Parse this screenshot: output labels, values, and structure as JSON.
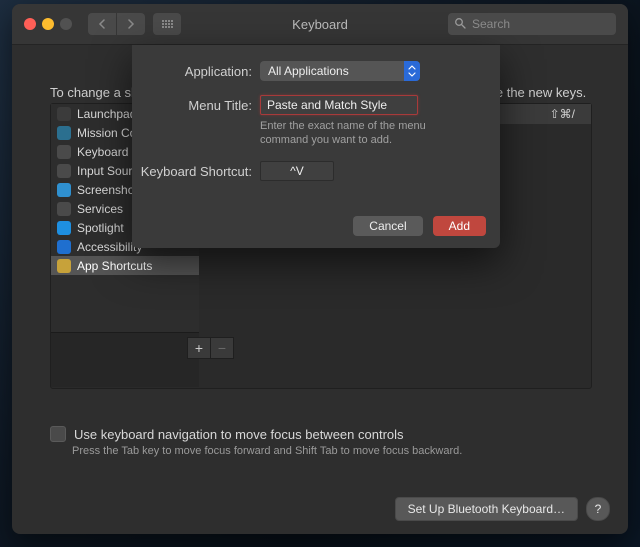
{
  "window": {
    "title": "Keyboard",
    "search_placeholder": "Search"
  },
  "main": {
    "intro_text": "To change a shortcut, select it, double-click the key combination, and then type the new keys.",
    "shortcut_display": "⇧⌘/"
  },
  "sidebar": {
    "items": [
      {
        "label": "Launchpad & Dock",
        "icon_bg": "#3b3b3b"
      },
      {
        "label": "Mission Control",
        "icon_bg": "#2b6f8f"
      },
      {
        "label": "Keyboard",
        "icon_bg": "#4a4a4a"
      },
      {
        "label": "Input Sources",
        "icon_bg": "#4a4a4a"
      },
      {
        "label": "Screenshots",
        "icon_bg": "#2f90d0"
      },
      {
        "label": "Services",
        "icon_bg": "#4a4a4a"
      },
      {
        "label": "Spotlight",
        "icon_bg": "#1e8fe0"
      },
      {
        "label": "Accessibility",
        "icon_bg": "#1f6fcf"
      },
      {
        "label": "App Shortcuts",
        "icon_bg": "#c7a23a"
      }
    ],
    "selected_index": 8
  },
  "addremove": {
    "plus": "+",
    "minus": "−"
  },
  "keyboard_nav": {
    "checkbox_label": "Use keyboard navigation to move focus between controls",
    "hint": "Press the Tab key to move focus forward and Shift Tab to move focus backward."
  },
  "footer": {
    "bluetooth": "Set Up Bluetooth Keyboard…",
    "help": "?"
  },
  "sheet": {
    "application_label": "Application:",
    "application_value": "All Applications",
    "menu_title_label": "Menu Title:",
    "menu_title_value": "Paste and Match Style",
    "help_text": "Enter the exact name of the menu command you want to add.",
    "shortcut_label": "Keyboard Shortcut:",
    "shortcut_value": "^V",
    "cancel": "Cancel",
    "add": "Add"
  }
}
